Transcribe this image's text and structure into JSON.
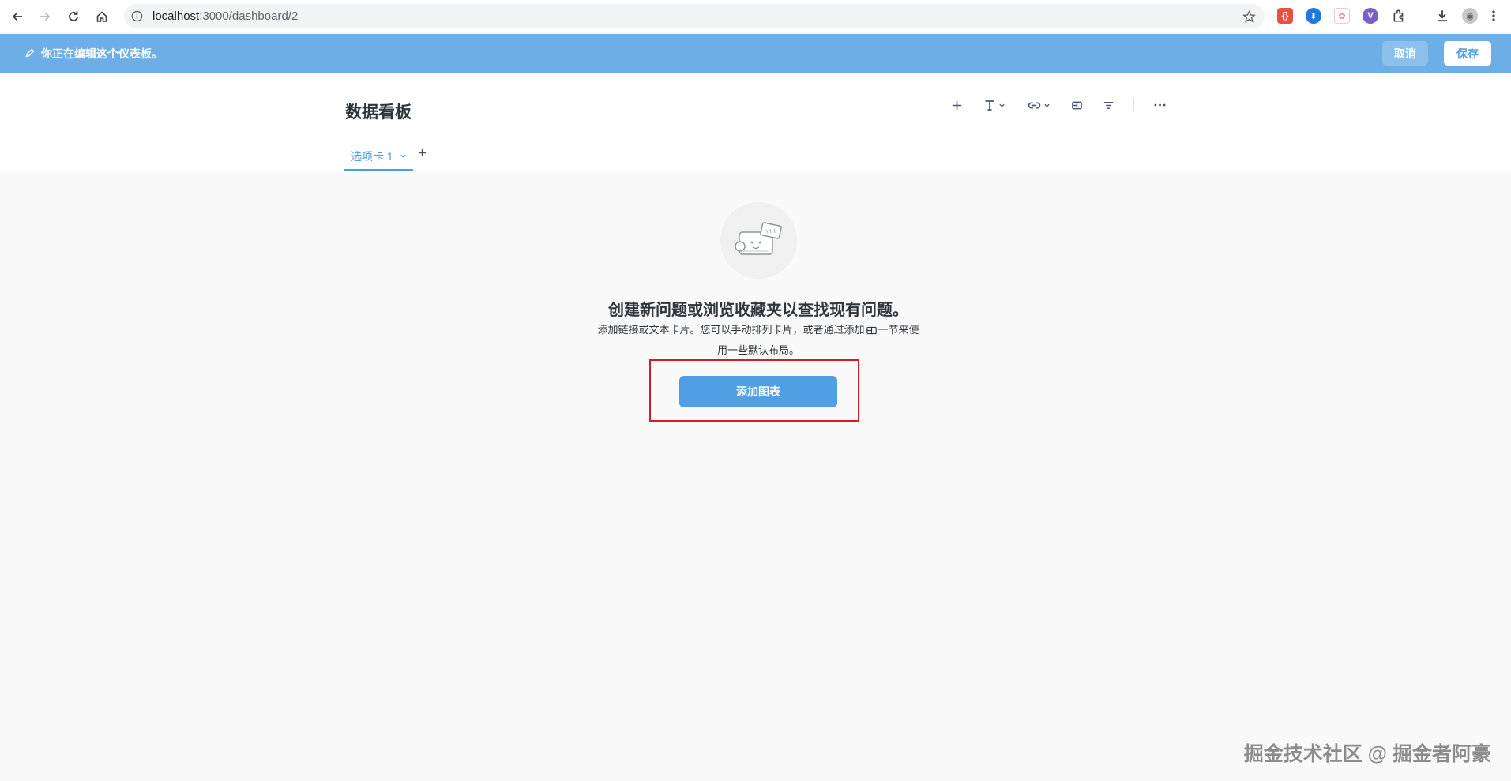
{
  "browser": {
    "url_host": "localhost",
    "url_rest": ":3000/dashboard/2"
  },
  "banner": {
    "text": "你正在编辑这个仪表板。",
    "cancel_label": "取消",
    "save_label": "保存",
    "color": "#6daee6"
  },
  "dashboard": {
    "title": "数据看板",
    "tabs": [
      {
        "label": "选项卡 1"
      }
    ]
  },
  "empty_state": {
    "title": "创建新问题或浏览收藏夹以查找现有问题。",
    "desc_part1": "添加链接或文本卡片。您可以手动排列卡片，或者通过添加",
    "desc_part2": "一节来使用一些默认布局。",
    "button_label": "添加图表"
  },
  "watermark": "掘金技术社区 @ 掘金者阿豪",
  "accent_color": "#509ee3"
}
